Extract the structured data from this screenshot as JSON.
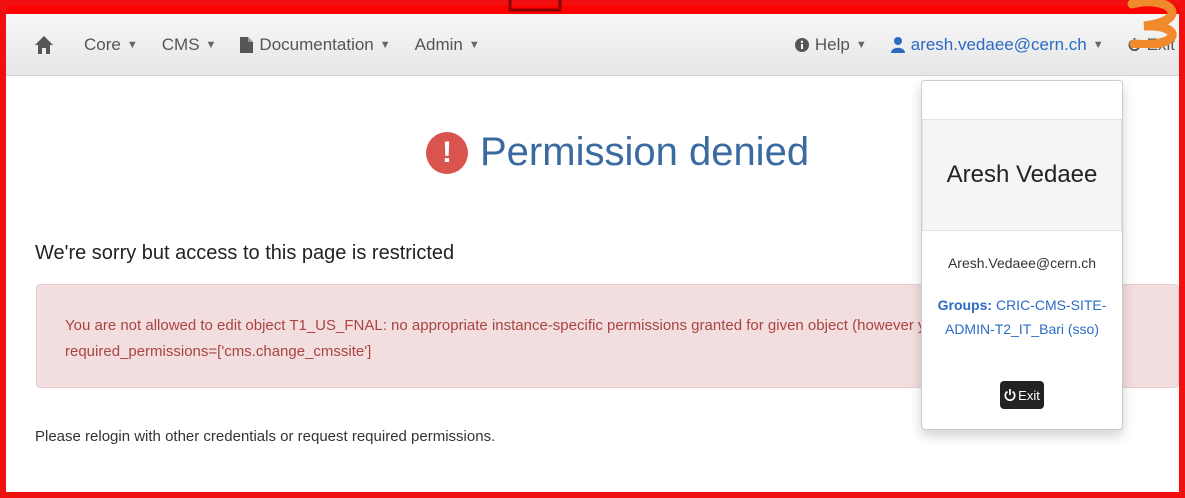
{
  "navbar": {
    "home_icon": "home-icon",
    "items": [
      {
        "label": "Core"
      },
      {
        "label": "CMS"
      },
      {
        "label": "Documentation",
        "icon": "file-icon"
      },
      {
        "label": "Admin"
      }
    ],
    "help_label": "Help",
    "help_icon": "info-icon",
    "user_label": "aresh.vedaee@cern.ch",
    "user_icon": "user-icon",
    "exit_label": "Exit"
  },
  "page": {
    "title": "Permission denied",
    "alert_icon": "exclamation-icon",
    "sorry": "We're sorry but access to this page is restricted",
    "alert_line1": "You are not allowed to edit object T1_US_FNAL: no appropriate instance-specific permissions granted for given object (however you are ab",
    "alert_line2": "required_permissions=['cms.change_cmssite']",
    "relogin": "Please relogin with other credentials or request required permissions."
  },
  "user_dropdown": {
    "name": "Aresh Vedaee",
    "email": "Aresh.Vedaee@cern.ch",
    "groups_label": "Groups:",
    "groups_line1": "CRIC-CMS-SITE-",
    "groups_line2": "ADMIN-T2_IT_Bari (sso)",
    "exit_label": "Exit",
    "exit_icon": "power-icon"
  },
  "colors": {
    "frame": "#f01010",
    "title": "#3b6aa0",
    "link": "#2a6bc4",
    "alert_bg": "#f2dede",
    "alert_text": "#a94442",
    "annotation_orange": "#f08a2c"
  }
}
